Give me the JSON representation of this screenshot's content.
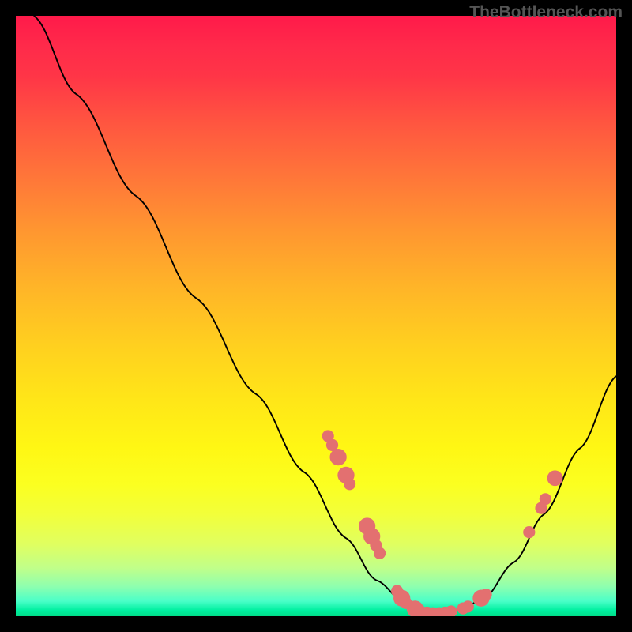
{
  "watermark": "TheBottleneck.com",
  "chart_data": {
    "type": "line",
    "title": "",
    "xlabel": "",
    "ylabel": "",
    "xlim": [
      0,
      100
    ],
    "ylim": [
      0,
      100
    ],
    "note": "No axes, ticks, or numeric labels are shown in the image; x/y units are unknown. Values below are normalized 0-100 along each axis, estimated from the rendered curve shape.",
    "background_gradient": {
      "top": "#ff1a4a",
      "mid_upper": "#ff9730",
      "mid": "#ffe618",
      "lower": "#c0ff8a",
      "bottom": "#00dd88"
    },
    "curve": [
      {
        "x": 3,
        "y": 100
      },
      {
        "x": 10,
        "y": 87
      },
      {
        "x": 20,
        "y": 70
      },
      {
        "x": 30,
        "y": 53
      },
      {
        "x": 40,
        "y": 37
      },
      {
        "x": 48,
        "y": 24
      },
      {
        "x": 55,
        "y": 13
      },
      {
        "x": 60,
        "y": 6
      },
      {
        "x": 65,
        "y": 2
      },
      {
        "x": 70,
        "y": 0.5
      },
      {
        "x": 74,
        "y": 1
      },
      {
        "x": 78,
        "y": 3
      },
      {
        "x": 83,
        "y": 9
      },
      {
        "x": 88,
        "y": 17
      },
      {
        "x": 94,
        "y": 28
      },
      {
        "x": 100,
        "y": 40
      }
    ],
    "markers": [
      {
        "x": 52.0,
        "y": 30.0,
        "r": 1.0
      },
      {
        "x": 52.7,
        "y": 28.5,
        "r": 1.0
      },
      {
        "x": 53.7,
        "y": 26.5,
        "r": 1.4
      },
      {
        "x": 55.0,
        "y": 23.5,
        "r": 1.4
      },
      {
        "x": 55.6,
        "y": 22.0,
        "r": 1.0
      },
      {
        "x": 58.5,
        "y": 15.0,
        "r": 1.4
      },
      {
        "x": 59.3,
        "y": 13.3,
        "r": 1.4
      },
      {
        "x": 60.0,
        "y": 11.8,
        "r": 1.0
      },
      {
        "x": 60.6,
        "y": 10.5,
        "r": 1.0
      },
      {
        "x": 63.5,
        "y": 4.2,
        "r": 1.0
      },
      {
        "x": 64.3,
        "y": 3.0,
        "r": 1.4
      },
      {
        "x": 65.0,
        "y": 2.2,
        "r": 1.0
      },
      {
        "x": 66.5,
        "y": 1.2,
        "r": 1.4
      },
      {
        "x": 67.3,
        "y": 0.9,
        "r": 1.0
      },
      {
        "x": 68.5,
        "y": 0.6,
        "r": 1.0
      },
      {
        "x": 69.5,
        "y": 0.5,
        "r": 1.0
      },
      {
        "x": 70.5,
        "y": 0.5,
        "r": 1.0
      },
      {
        "x": 71.5,
        "y": 0.6,
        "r": 1.0
      },
      {
        "x": 72.5,
        "y": 0.8,
        "r": 1.0
      },
      {
        "x": 74.5,
        "y": 1.3,
        "r": 1.0
      },
      {
        "x": 75.3,
        "y": 1.6,
        "r": 1.0
      },
      {
        "x": 77.5,
        "y": 3.0,
        "r": 1.4
      },
      {
        "x": 78.3,
        "y": 3.6,
        "r": 1.0
      },
      {
        "x": 85.5,
        "y": 14.0,
        "r": 1.0
      },
      {
        "x": 87.5,
        "y": 18.0,
        "r": 1.0
      },
      {
        "x": 88.2,
        "y": 19.5,
        "r": 1.0
      },
      {
        "x": 89.8,
        "y": 23.0,
        "r": 1.3
      }
    ],
    "marker_color": "#e37070",
    "line_color": "#000000"
  }
}
